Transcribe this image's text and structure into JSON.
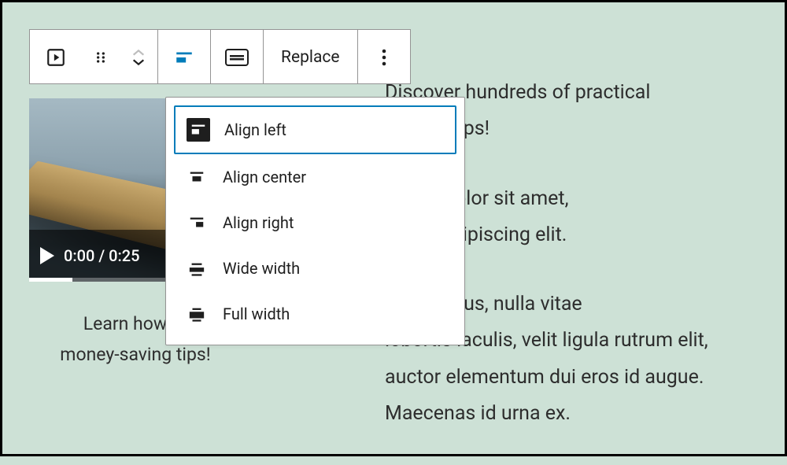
{
  "toolbar": {
    "replace_label": "Replace"
  },
  "dropdown": {
    "items": [
      {
        "label": "Align left"
      },
      {
        "label": "Align center"
      },
      {
        "label": "Align right"
      },
      {
        "label": "Wide width"
      },
      {
        "label": "Full width"
      }
    ]
  },
  "video": {
    "current_time": "0:00",
    "duration": "0:25",
    "time_display": "0:00 / 0:25"
  },
  "caption": {
    "line1": "Learn how to",
    "line2": "money-saving tips!"
  },
  "paragraphs": {
    "p1": "Discover hundreds of practical",
    "p1b": "-saving tips!",
    "p2a": "ipsum dolor sit amet,",
    "p2b": "ctetur adipiscing elit.",
    "p3a": "itur tempus, nulla vitae",
    "p3b": "lobortis iaculis, velit ligula rutrum elit, auctor elementum dui eros id augue. Maecenas id urna ex."
  }
}
